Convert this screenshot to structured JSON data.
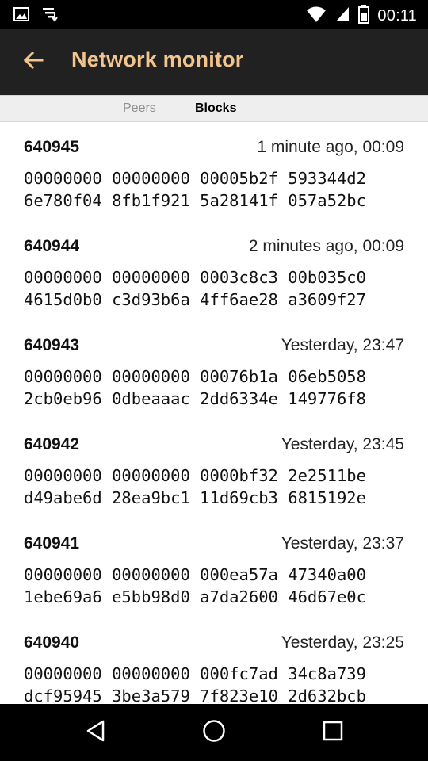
{
  "status_bar": {
    "time": "00:11",
    "icons": [
      "image-icon",
      "download-queue-icon",
      "wifi-icon",
      "cellular-signal-icon",
      "battery-icon"
    ]
  },
  "app_bar": {
    "title": "Network monitor",
    "back_icon": "arrow-back-icon",
    "title_color": "#f3c58e"
  },
  "tabs": [
    {
      "label": "Peers",
      "selected": false
    },
    {
      "label": "Blocks",
      "selected": true
    }
  ],
  "blocks": [
    {
      "number": "640945",
      "time": "1 minute ago, 00:09",
      "hash_line1": "00000000 00000000 00005b2f 593344d2",
      "hash_line2": "6e780f04 8fb1f921 5a28141f 057a52bc"
    },
    {
      "number": "640944",
      "time": "2 minutes ago, 00:09",
      "hash_line1": "00000000 00000000 0003c8c3 00b035c0",
      "hash_line2": "4615d0b0 c3d93b6a 4ff6ae28 a3609f27"
    },
    {
      "number": "640943",
      "time": "Yesterday, 23:47",
      "hash_line1": "00000000 00000000 00076b1a 06eb5058",
      "hash_line2": "2cb0eb96 0dbeaaac 2dd6334e 149776f8"
    },
    {
      "number": "640942",
      "time": "Yesterday, 23:45",
      "hash_line1": "00000000 00000000 0000bf32 2e2511be",
      "hash_line2": "d49abe6d 28ea9bc1 11d69cb3 6815192e"
    },
    {
      "number": "640941",
      "time": "Yesterday, 23:37",
      "hash_line1": "00000000 00000000 000ea57a 47340a00",
      "hash_line2": "1ebe69a6 e5bb98d0 a7da2600 46d67e0c"
    },
    {
      "number": "640940",
      "time": "Yesterday, 23:25",
      "hash_line1": "00000000 00000000 000fc7ad 34c8a739",
      "hash_line2": "dcf95945 3be3a579 7f823e10 2d632bcb"
    }
  ],
  "nav_bar": {
    "icons": [
      "nav-back-icon",
      "nav-home-icon",
      "nav-recents-icon"
    ]
  }
}
